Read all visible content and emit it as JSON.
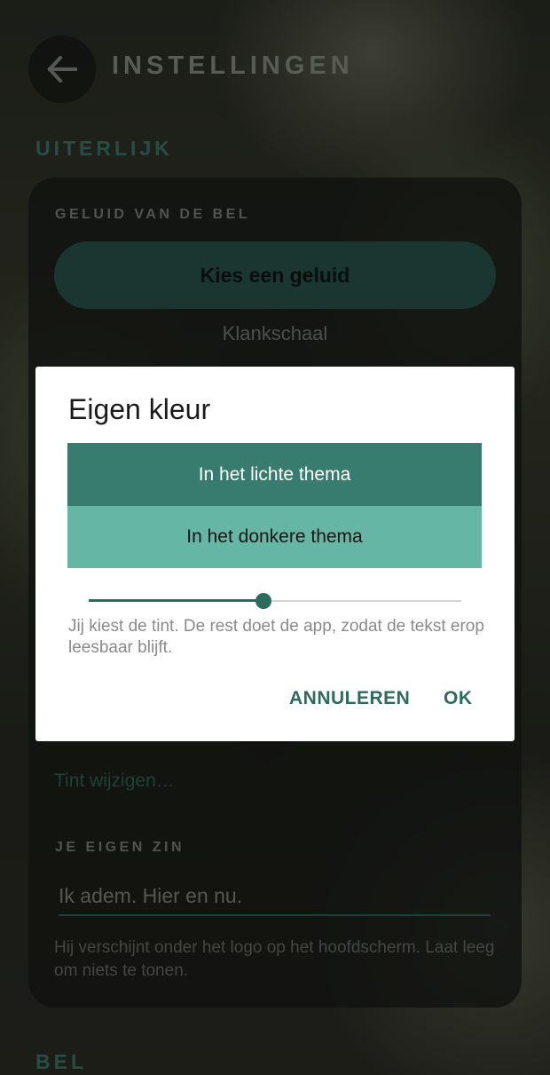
{
  "header": {
    "title": "INSTELLINGEN",
    "back_icon": "arrow-left-icon"
  },
  "sections": {
    "appearance_heading": "UITERLIJK",
    "bell_heading": "BEL"
  },
  "bell_sound": {
    "label": "GELUID VAN DE BEL",
    "button_label": "Kies een geluid",
    "current_value": "Klankschaal"
  },
  "tint": {
    "link_label": "Tint wijzigen…"
  },
  "own_phrase": {
    "label": "JE EIGEN ZIN",
    "value": "Ik adem. Hier en nu.",
    "helper": "Hij verschijnt onder het logo op het hoofdscherm. Laat leeg om niets te tonen."
  },
  "dialog": {
    "title": "Eigen kleur",
    "light_theme_label": "In het lichte thema",
    "dark_theme_label": "In het donkere thema",
    "slider_value_fraction": 0.47,
    "help_text": "Jij kiest de tint. De rest doet de app, zodat de tekst erop leesbaar blijft.",
    "cancel_label": "ANNULEREN",
    "ok_label": "OK"
  },
  "colors": {
    "accent": "#2f6a5f",
    "light_theme_preview": "#377c6f",
    "dark_theme_preview": "#66b6a6"
  }
}
